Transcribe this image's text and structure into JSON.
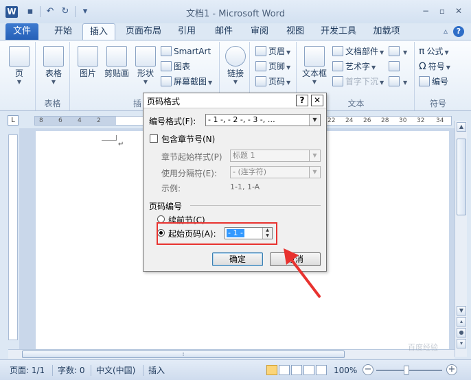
{
  "app": {
    "logo": "W",
    "title": "文档1 - Microsoft Word"
  },
  "window_controls": {
    "minimize": "−",
    "restore": "▫",
    "close": "✕"
  },
  "quick_access": [
    "save",
    "undo",
    "redo",
    "customize"
  ],
  "tabs": [
    {
      "label": "文件"
    },
    {
      "label": "开始"
    },
    {
      "label": "插入"
    },
    {
      "label": "页面布局"
    },
    {
      "label": "引用"
    },
    {
      "label": "邮件"
    },
    {
      "label": "审阅"
    },
    {
      "label": "视图"
    },
    {
      "label": "开发工具"
    },
    {
      "label": "加载项"
    }
  ],
  "active_tab": "插入",
  "ribbon": {
    "pages_btn": "页",
    "tables_btn": "表格",
    "tables_group": "表格",
    "picture_btn": "图片",
    "clipart_btn": "剪贴画",
    "shapes_btn": "形状",
    "illustrations_group": "插",
    "smartart_btn": "SmartArt",
    "chart_btn": "图表",
    "screenshot_btn": "屏幕截图",
    "links_btn": "链接",
    "header_btn": "页眉",
    "footer_btn": "页脚",
    "pagenum_btn": "页码",
    "textbox_btn": "文本框",
    "quickparts_btn": "文档部件",
    "wordart_btn": "艺术字",
    "dropcap_btn": "首字下沉",
    "text_group": "文本",
    "equation_btn": "公式",
    "symbol_btn": "符号",
    "numbering_btn": "编号",
    "symbols_group": "符号"
  },
  "ruler": {
    "corner": "L",
    "ticks": [
      "8",
      "6",
      "4",
      "2",
      "22",
      "24",
      "26",
      "28",
      "30",
      "32",
      "34"
    ]
  },
  "document": {
    "para_mark": "↵"
  },
  "dialog": {
    "title": "页码格式",
    "help_btn": "?",
    "close_btn": "✕",
    "number_format_label": "编号格式(F):",
    "number_format_value": "- 1 -, - 2 -, - 3 -, …",
    "include_chapter_label": "包含章节号(N)",
    "chapter_style_label": "章节起始样式(P)",
    "chapter_style_value": "标题 1",
    "separator_label": "使用分隔符(E):",
    "separator_value": "-  (连字符)",
    "example_label": "示例:",
    "example_value": "1-1, 1-A",
    "page_numbering_label": "页码编号",
    "continue_label": "续前节(C)",
    "start_at_label": "起始页码(A):",
    "start_at_value": "- 1 -",
    "ok_btn": "确定",
    "cancel_btn": "取消"
  },
  "status": {
    "page": "页面: 1/1",
    "words": "字数: 0",
    "language": "中文(中国)",
    "mode": "插入",
    "zoom": "100%"
  },
  "watermark": "百度经验",
  "colors": {
    "annotation_red": "#e8322f",
    "file_tab": "#2560b8",
    "selection_blue": "#3399ff"
  }
}
